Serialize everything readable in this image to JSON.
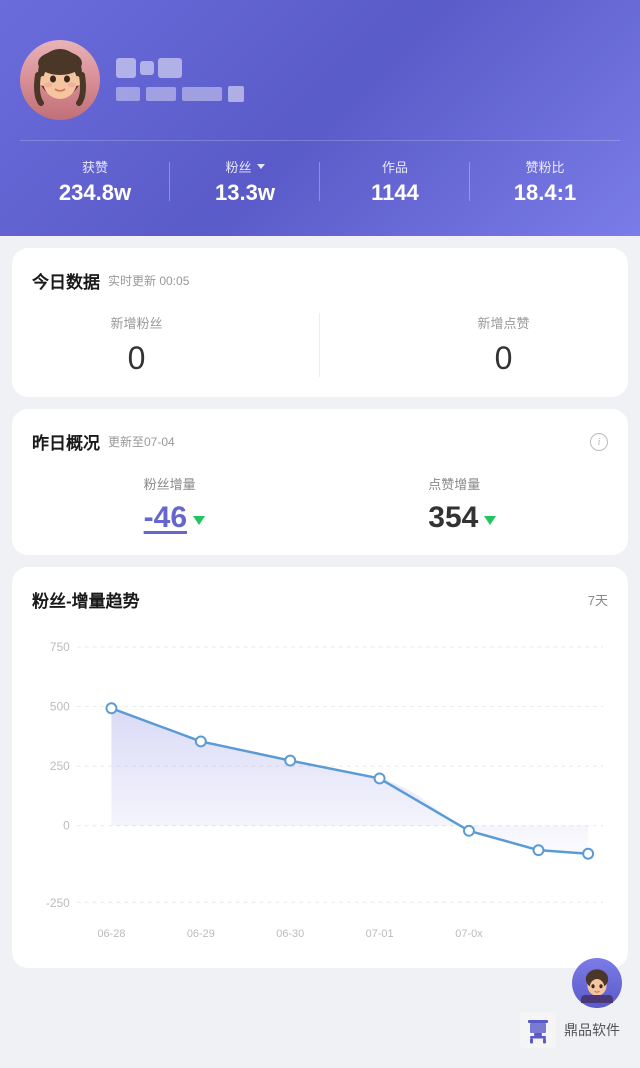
{
  "profile": {
    "avatar_alt": "用户头像",
    "stats": [
      {
        "label": "获赞",
        "value": "234.8w",
        "has_dropdown": false
      },
      {
        "label": "粉丝",
        "value": "13.3w",
        "has_dropdown": true
      },
      {
        "label": "作品",
        "value": "1144",
        "has_dropdown": false
      },
      {
        "label": "赞粉比",
        "value": "18.4:1",
        "has_dropdown": false
      }
    ]
  },
  "today_data": {
    "section_title": "今日数据",
    "update_text": "实时更新 00:05",
    "new_fans_label": "新增粉丝",
    "new_fans_value": "0",
    "new_likes_label": "新增点赞",
    "new_likes_value": "0"
  },
  "yesterday_data": {
    "section_title": "昨日概况",
    "update_text": "更新至07-04",
    "fans_increase_label": "粉丝增量",
    "fans_increase_value": "-46",
    "likes_increase_label": "点赞增量",
    "likes_increase_value": "354"
  },
  "chart": {
    "title": "粉丝-增量趋势",
    "days_label": "7天",
    "y_labels": [
      "750",
      "500",
      "250",
      "0",
      "-250"
    ],
    "x_labels": [
      "06-28",
      "06-29",
      "06-30",
      "07-01",
      "07-0x"
    ],
    "data_points": [
      510,
      380,
      305,
      235,
      30,
      -40,
      -60
    ]
  },
  "watermark": {
    "name": "鼎品软件",
    "logo_alt": "鼎品软件logo"
  }
}
